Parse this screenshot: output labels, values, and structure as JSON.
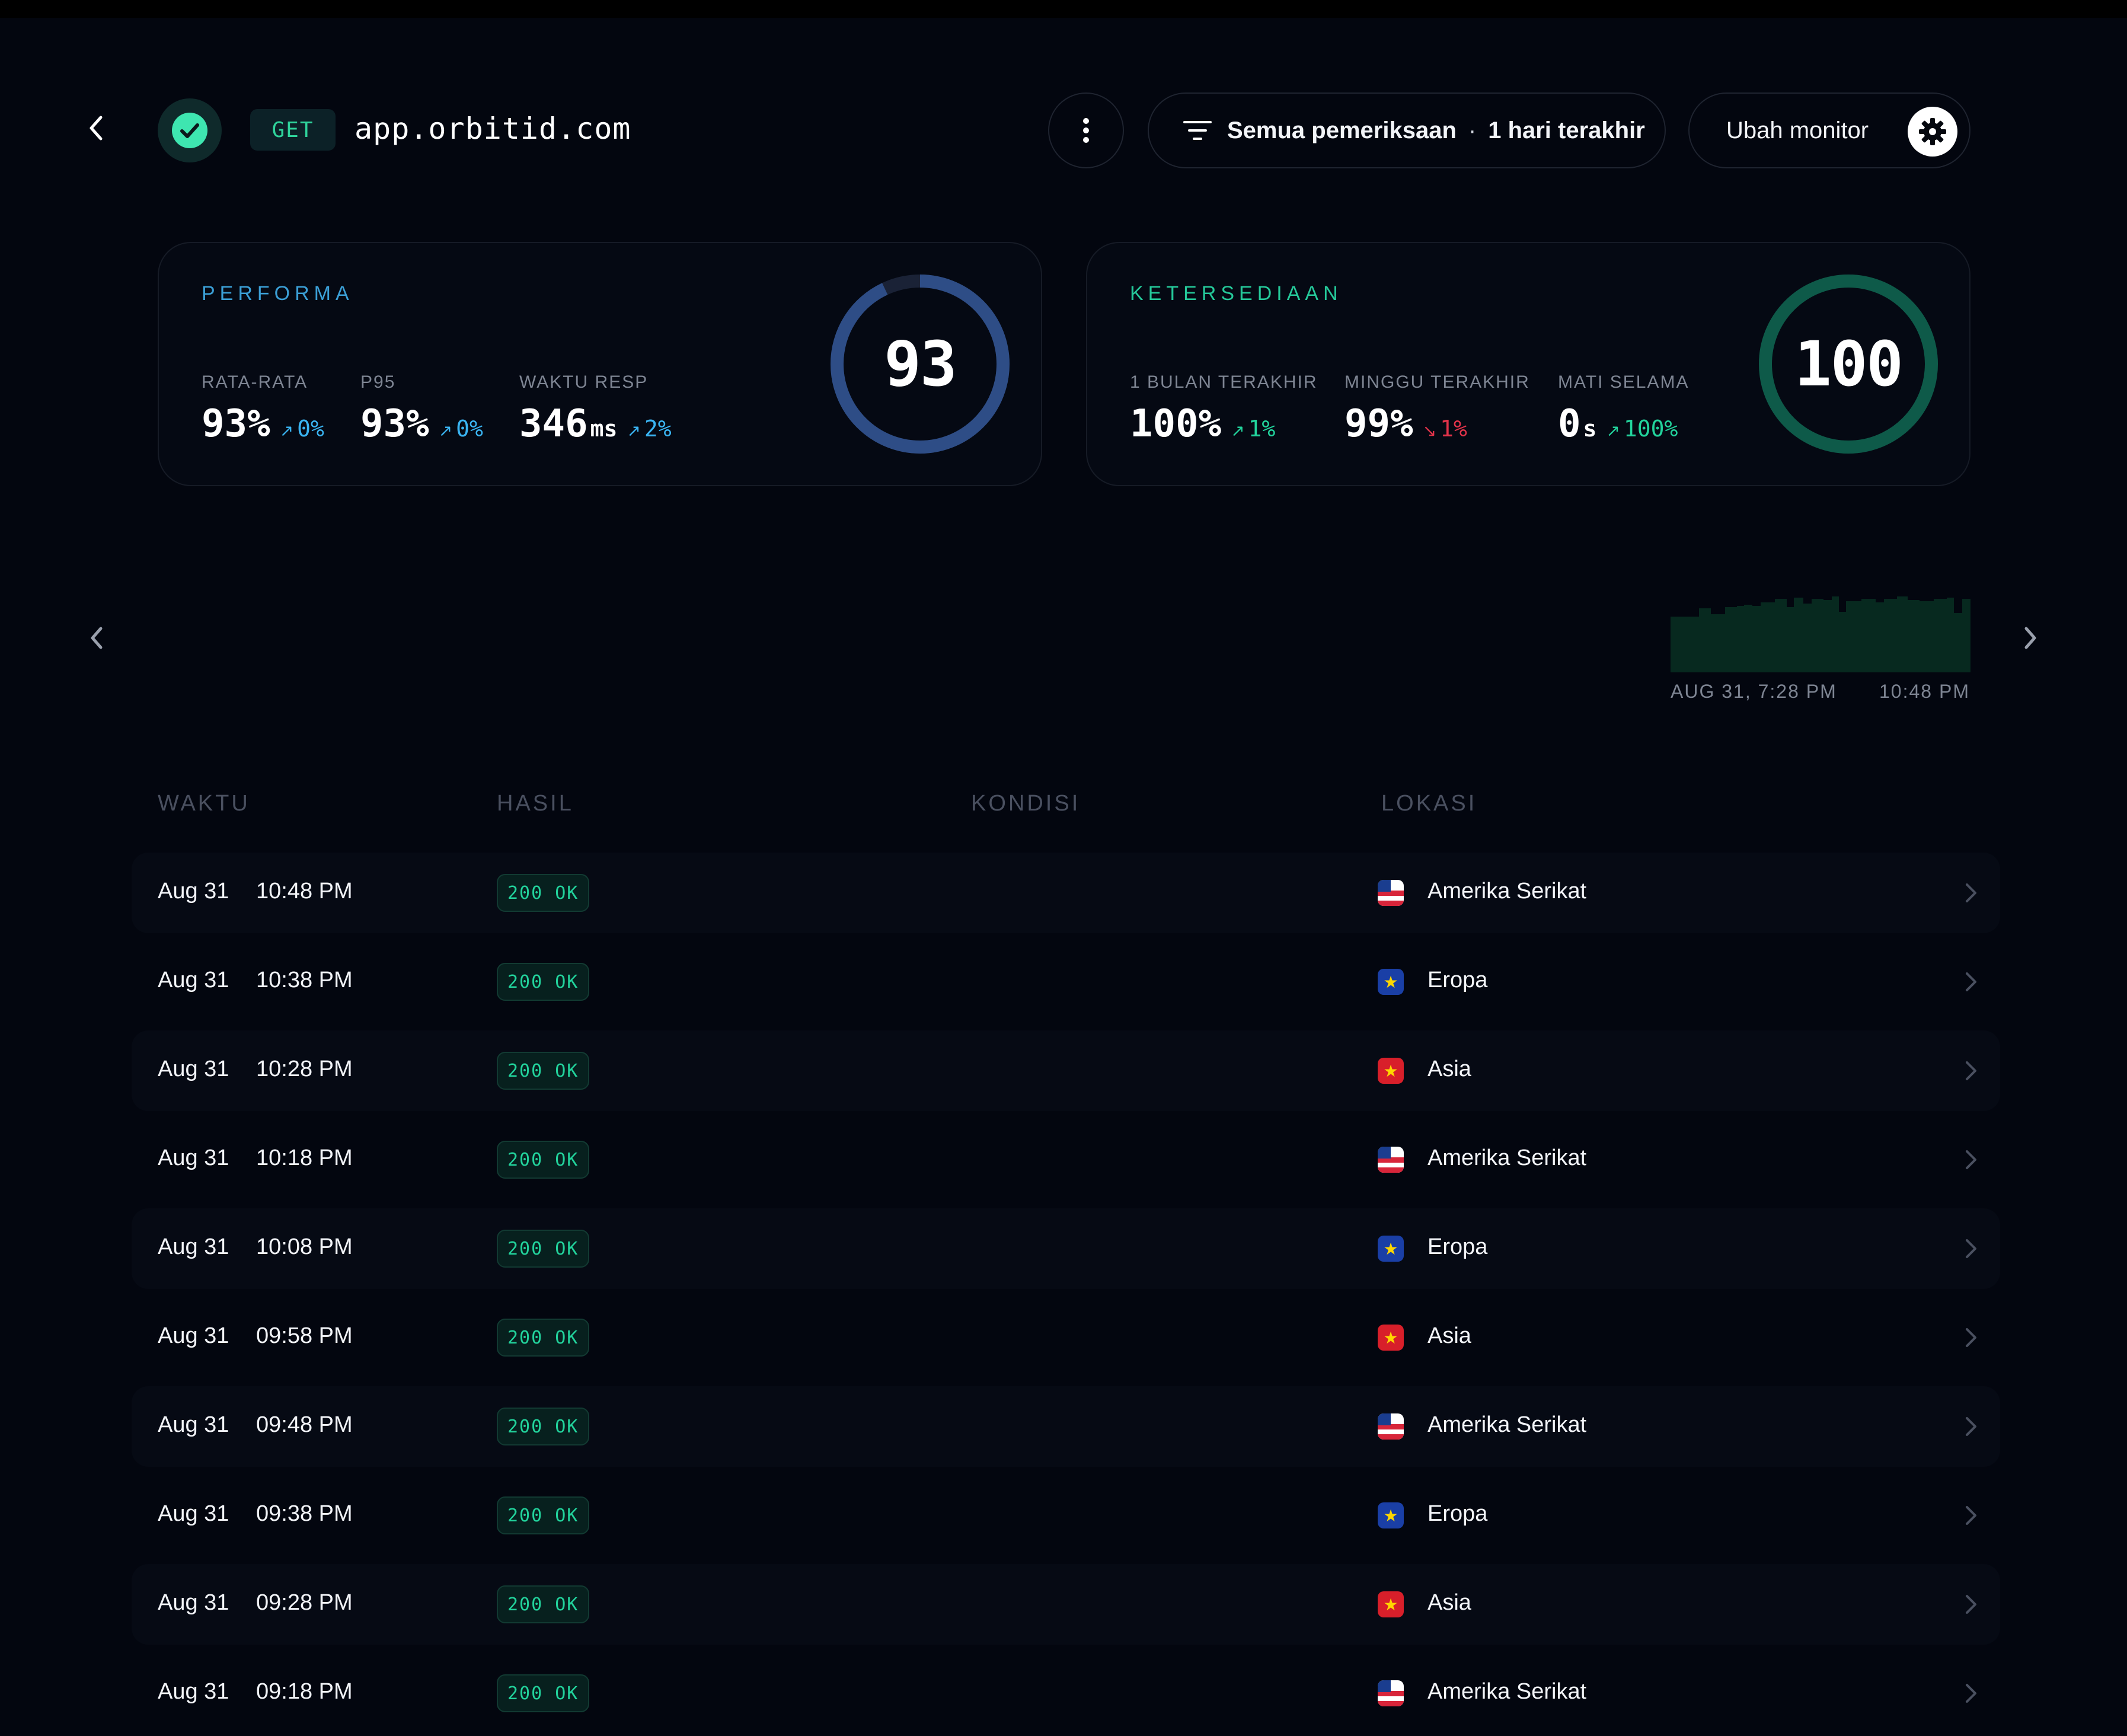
{
  "header": {
    "method": "GET",
    "url": "app.orbitid.com",
    "filter_label": "Semua pemeriksaan",
    "filter_separator": "·",
    "filter_range": "1 hari terakhir",
    "edit_label": "Ubah monitor"
  },
  "performance": {
    "title": "PERFORMA",
    "score": "93",
    "score_fraction": 0.93,
    "metrics": [
      {
        "label": "RATA-RATA",
        "value": "93%",
        "unit": "",
        "delta": "0%",
        "direction": "up"
      },
      {
        "label": "P95",
        "value": "93%",
        "unit": "",
        "delta": "0%",
        "direction": "up"
      },
      {
        "label": "WAKTU RESP",
        "value": "346",
        "unit": "ms",
        "delta": "2%",
        "direction": "up"
      }
    ]
  },
  "availability": {
    "title": "KETERSEDIAAN",
    "score": "100",
    "score_fraction": 1.0,
    "metrics": [
      {
        "label": "1 BULAN TERAKHIR",
        "value": "100%",
        "unit": "",
        "delta": "1%",
        "direction": "up"
      },
      {
        "label": "MINGGU TERAKHIR",
        "value": "99%",
        "unit": "",
        "delta": "1%",
        "direction": "down"
      },
      {
        "label": "MATI SELAMA",
        "value": "0",
        "unit": "s",
        "delta": "100%",
        "direction": "up"
      }
    ]
  },
  "timeline": {
    "start_label": "AUG 31, 7:28 PM",
    "end_label": "10:48 PM"
  },
  "table": {
    "columns": [
      "WAKTU",
      "HASIL",
      "KONDISI",
      "LOKASI"
    ],
    "rows": [
      {
        "date": "Aug 31",
        "time": "10:48 PM",
        "result": "200 OK",
        "flag": "us",
        "location": "Amerika Serikat"
      },
      {
        "date": "Aug 31",
        "time": "10:38 PM",
        "result": "200 OK",
        "flag": "eu",
        "location": "Eropa"
      },
      {
        "date": "Aug 31",
        "time": "10:28 PM",
        "result": "200 OK",
        "flag": "asia",
        "location": "Asia"
      },
      {
        "date": "Aug 31",
        "time": "10:18 PM",
        "result": "200 OK",
        "flag": "us",
        "location": "Amerika Serikat"
      },
      {
        "date": "Aug 31",
        "time": "10:08 PM",
        "result": "200 OK",
        "flag": "eu",
        "location": "Eropa"
      },
      {
        "date": "Aug 31",
        "time": "09:58 PM",
        "result": "200 OK",
        "flag": "asia",
        "location": "Asia"
      },
      {
        "date": "Aug 31",
        "time": "09:48 PM",
        "result": "200 OK",
        "flag": "us",
        "location": "Amerika Serikat"
      },
      {
        "date": "Aug 31",
        "time": "09:38 PM",
        "result": "200 OK",
        "flag": "eu",
        "location": "Eropa"
      },
      {
        "date": "Aug 31",
        "time": "09:28 PM",
        "result": "200 OK",
        "flag": "asia",
        "location": "Asia"
      },
      {
        "date": "Aug 31",
        "time": "09:18 PM",
        "result": "200 OK",
        "flag": "us",
        "location": "Amerika Serikat"
      }
    ]
  },
  "icons": {
    "back": "chevron-left-icon",
    "status": "check-circle-icon",
    "more": "more-vertical-icon",
    "filter": "filter-icon",
    "settings": "gear-icon",
    "prev": "chevron-left-icon",
    "next": "chevron-right-icon",
    "row": "chevron-right-icon"
  },
  "colors": {
    "background": "#03060f",
    "accent_green": "#22d39c",
    "accent_blue": "#3ab4f2",
    "danger": "#e2334a",
    "perf_ring": "#2e4d86",
    "avail_ring": "#0e5a49"
  }
}
